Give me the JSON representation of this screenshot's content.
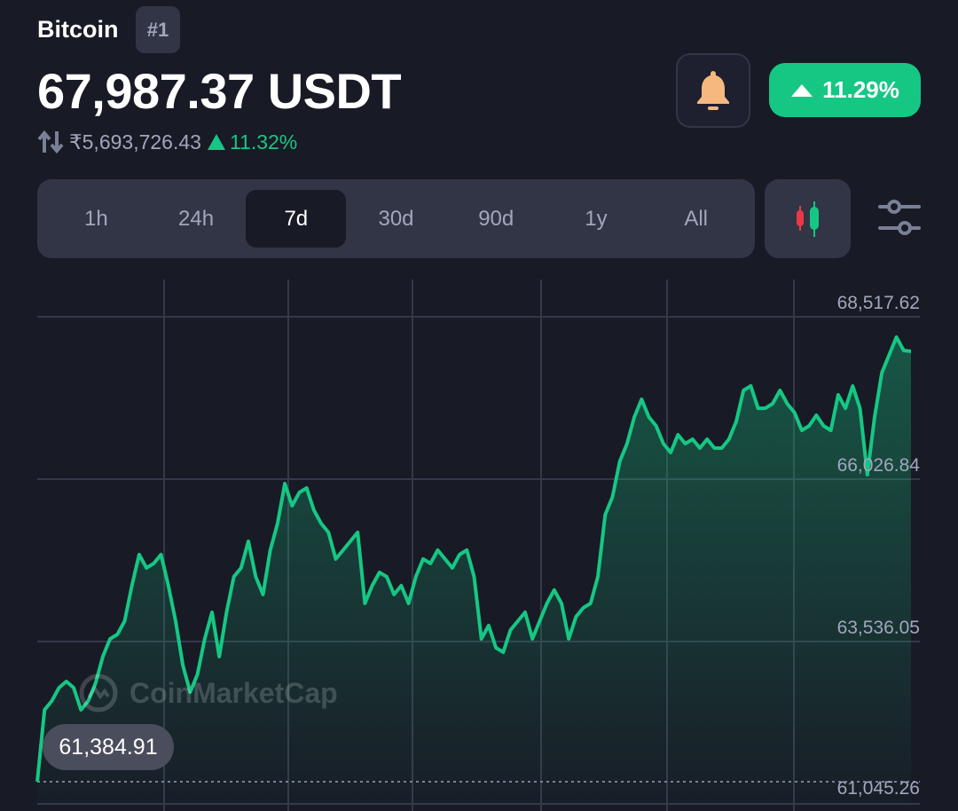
{
  "coin": {
    "name": "Bitcoin",
    "rank": "#1",
    "price": "67,987.37 USDT",
    "inr_price": "₹5,693,726.43",
    "inr_change": "11.32%",
    "change_badge": "11.29%"
  },
  "tabs": [
    {
      "label": "1h"
    },
    {
      "label": "24h"
    },
    {
      "label": "7d",
      "active": true
    },
    {
      "label": "30d"
    },
    {
      "label": "90d"
    },
    {
      "label": "1y"
    },
    {
      "label": "All"
    }
  ],
  "icons": {
    "bell": "bell-icon",
    "candle": "candlestick-icon",
    "settings": "sliders-icon",
    "swap": "swap-arrows-icon"
  },
  "colors": {
    "up": "#16c784",
    "down": "#ea3943",
    "bell": "#f6b87e",
    "bg": "#181a25"
  },
  "watermark": "CoinMarketCap",
  "chart_data": {
    "type": "area",
    "y_ticks": [
      "68,517.62",
      "66,026.84",
      "63,536.05",
      "61,045.26"
    ],
    "ylim": [
      61045.26,
      68517.62
    ],
    "min_label": "61,384.91",
    "grid": true,
    "values": [
      61385,
      62488,
      62624,
      62828,
      62923,
      62828,
      62488,
      62624,
      62896,
      63304,
      63577,
      63645,
      63849,
      64393,
      64870,
      64666,
      64734,
      64870,
      64393,
      63849,
      63168,
      62760,
      63032,
      63577,
      63985,
      63304,
      63985,
      64529,
      64666,
      65074,
      64529,
      64257,
      64938,
      65346,
      65959,
      65618,
      65822,
      65891,
      65550,
      65346,
      65210,
      64802,
      64938,
      65074,
      65210,
      64121,
      64393,
      64597,
      64529,
      64257,
      64393,
      64121,
      64529,
      64802,
      64734,
      64938,
      64802,
      64666,
      64870,
      64938,
      64529,
      63577,
      63781,
      63441,
      63372,
      63713,
      63849,
      63985,
      63577,
      63849,
      64121,
      64325,
      64121,
      63577,
      63917,
      64053,
      64121,
      64529,
      65482,
      65754,
      66299,
      66571,
      66979,
      67252,
      66979,
      66843,
      66571,
      66435,
      66707,
      66571,
      66639,
      66503,
      66639,
      66503,
      66503,
      66639,
      66911,
      67388,
      67456,
      67115,
      67115,
      67184,
      67388,
      67184,
      67047,
      66775,
      66843,
      67007,
      66843,
      66775,
      67320,
      67115,
      67456,
      67115,
      66095,
      66979,
      67660,
      67932,
      68204,
      68000,
      67987
    ]
  }
}
